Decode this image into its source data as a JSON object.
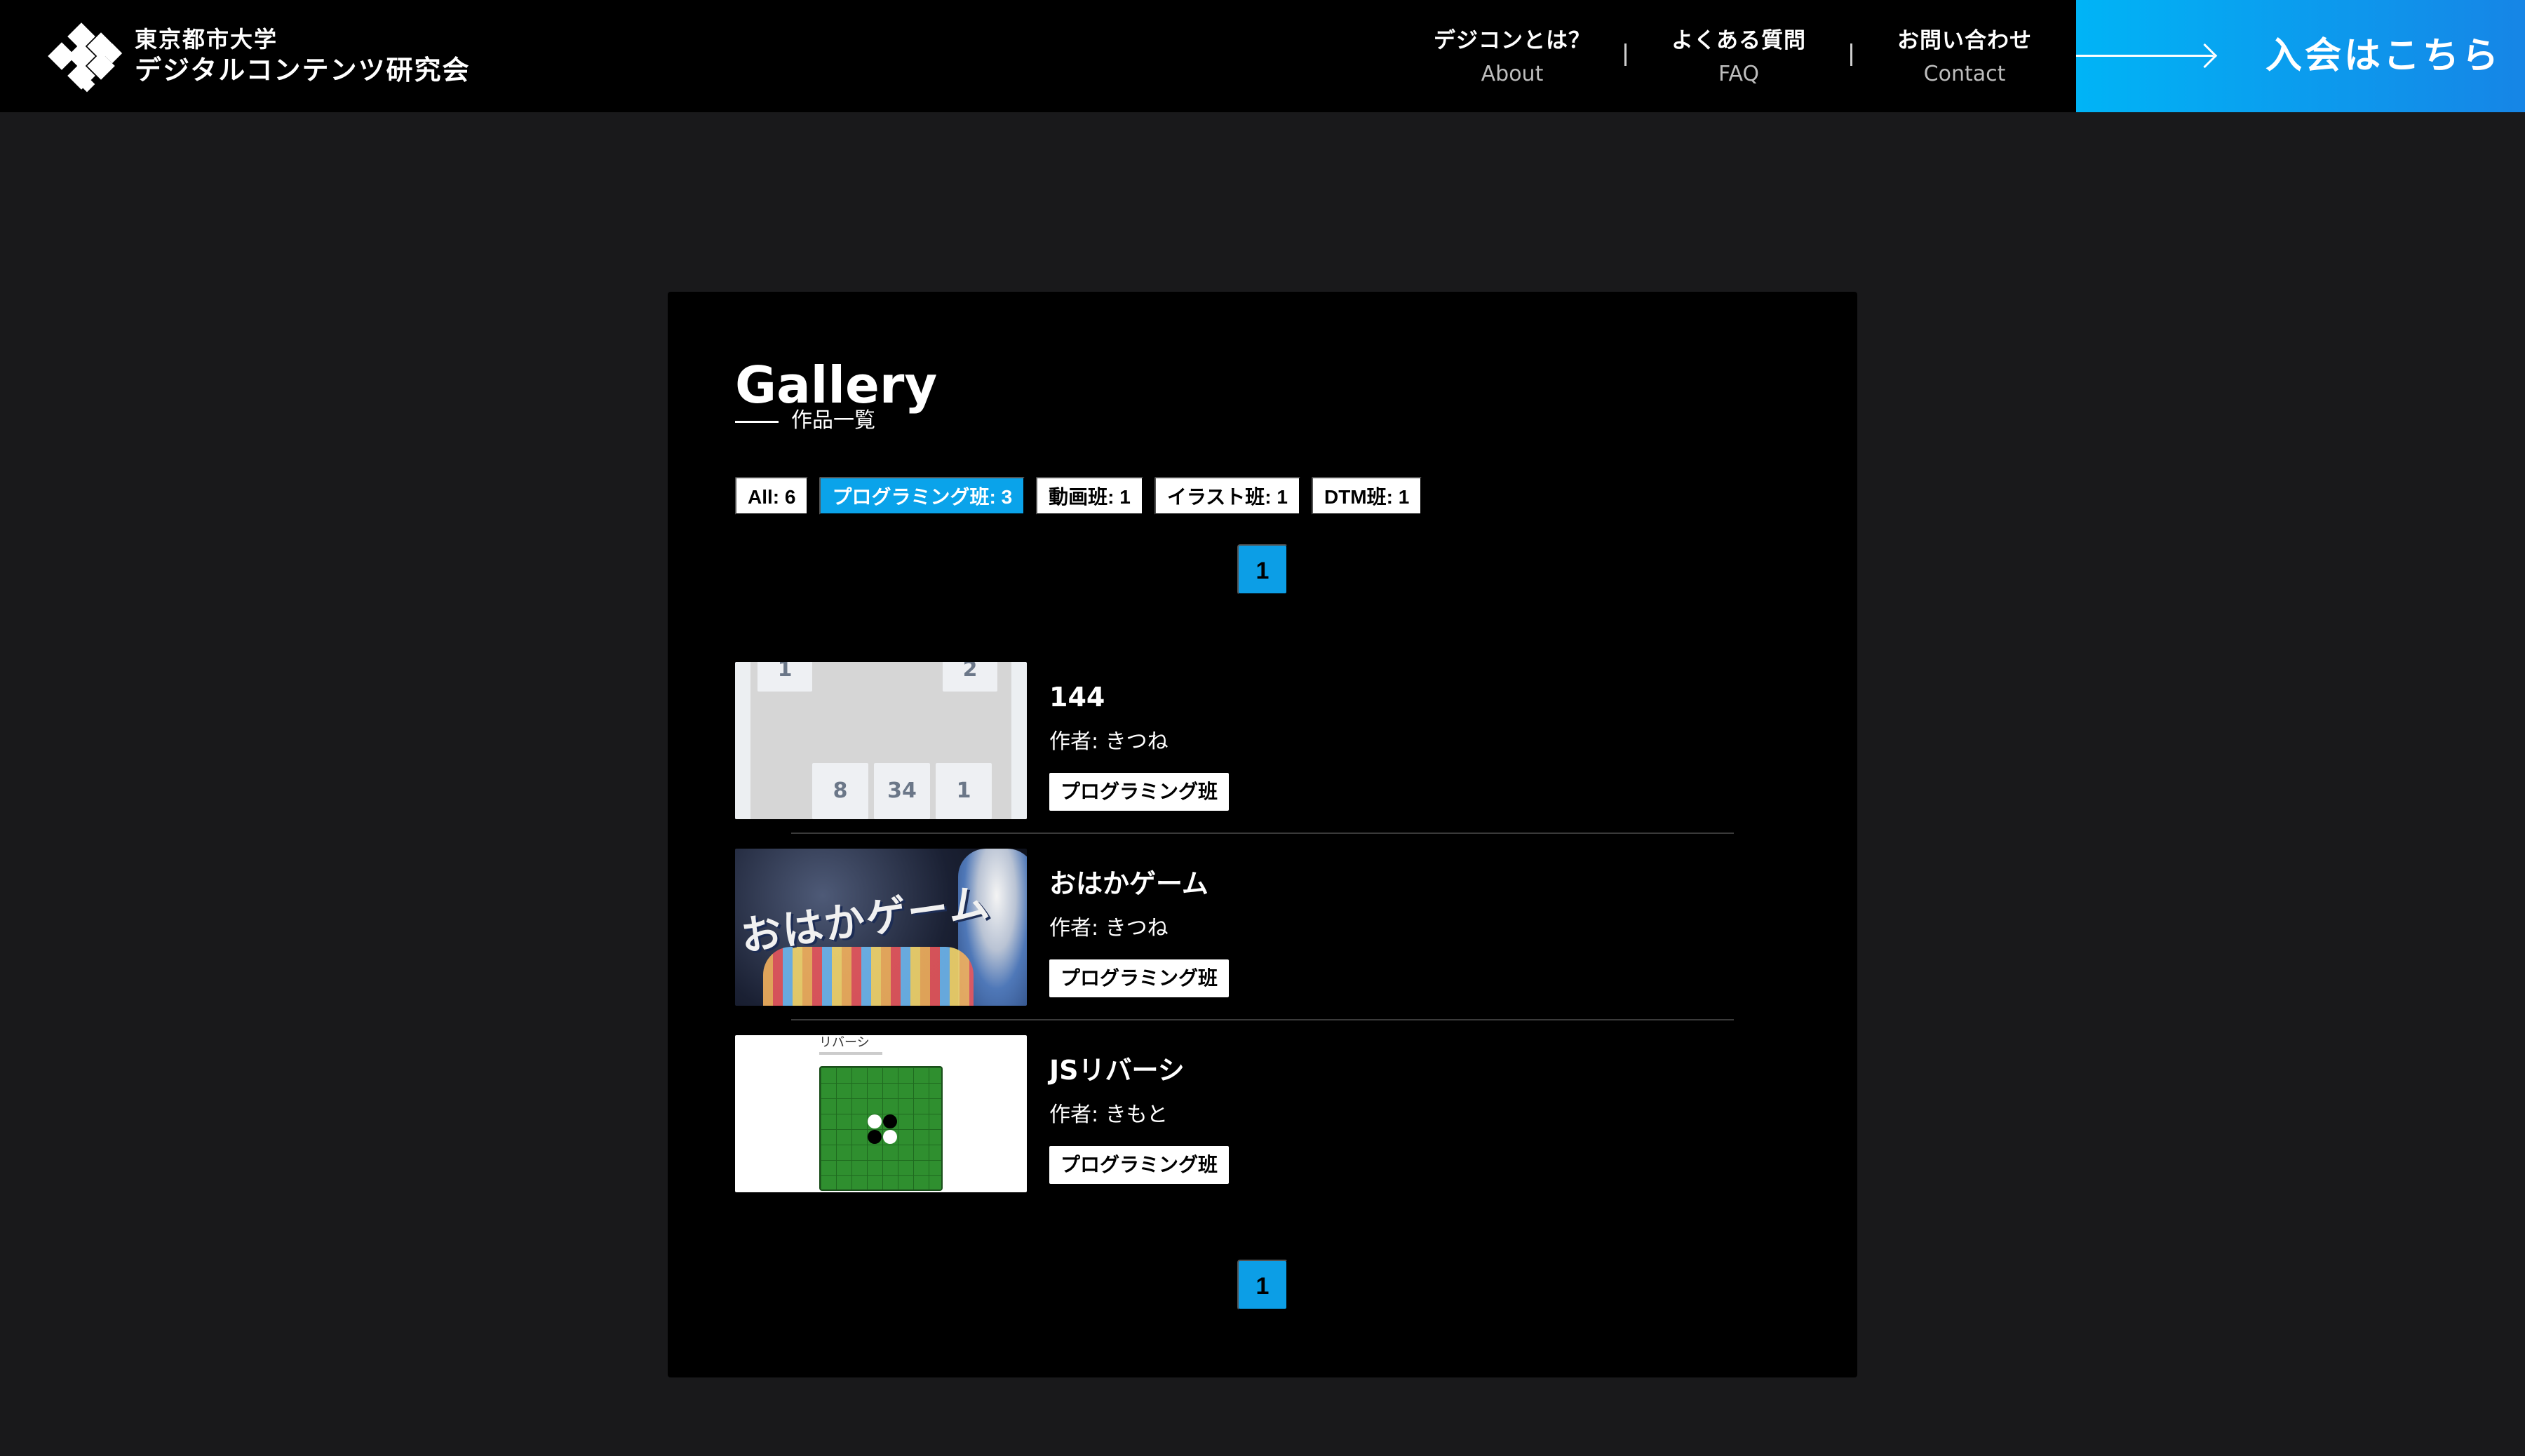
{
  "header": {
    "logo": {
      "line1": "東京都市大学",
      "line2": "デジタルコンテンツ研究会"
    },
    "nav": [
      {
        "jp": "デジコンとは？",
        "en": "About"
      },
      {
        "jp": "よくある質問",
        "en": "FAQ"
      },
      {
        "jp": "お問い合わせ",
        "en": "Contact"
      }
    ],
    "join_label": "入会はこちら"
  },
  "gallery": {
    "title": "Gallery",
    "subtitle": "作品一覧",
    "filters": [
      {
        "label": "All: 6",
        "active": false
      },
      {
        "label": "プログラミング班: 3",
        "active": true
      },
      {
        "label": "動画班: 1",
        "active": false
      },
      {
        "label": "イラスト班: 1",
        "active": false
      },
      {
        "label": "DTM班: 1",
        "active": false
      }
    ],
    "page": "1",
    "works": [
      {
        "title": "144",
        "author": "作者: きつね",
        "tag": "プログラミング班",
        "thumb_tiles": [
          "1",
          "2",
          "8",
          "34",
          "1"
        ]
      },
      {
        "title": "おはかゲーム",
        "author": "作者: きつね",
        "tag": "プログラミング班",
        "thumb_text": "おはかゲーム"
      },
      {
        "title": "JSリバーシ",
        "author": "作者: きもと",
        "tag": "プログラミング班",
        "thumb_caption": "リバーシ"
      }
    ]
  },
  "colors": {
    "accent": "#0aa3ea",
    "background": "#19191b",
    "panel": "#000000"
  }
}
